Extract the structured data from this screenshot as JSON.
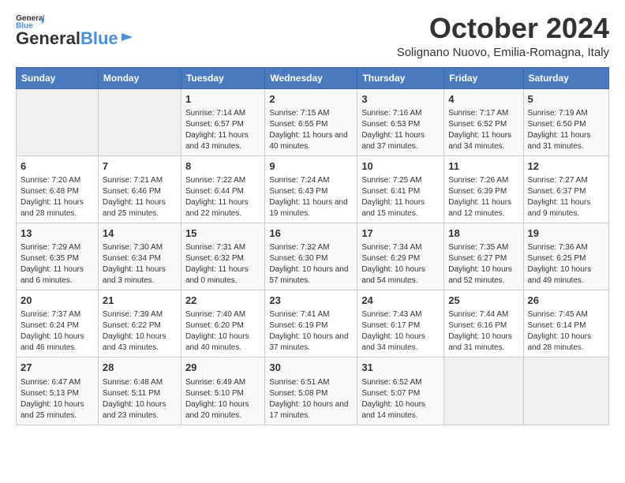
{
  "header": {
    "logo_line1": "General",
    "logo_line2": "Blue",
    "month": "October 2024",
    "location": "Solignano Nuovo, Emilia-Romagna, Italy"
  },
  "days_of_week": [
    "Sunday",
    "Monday",
    "Tuesday",
    "Wednesday",
    "Thursday",
    "Friday",
    "Saturday"
  ],
  "weeks": [
    [
      {
        "day": "",
        "info": ""
      },
      {
        "day": "",
        "info": ""
      },
      {
        "day": "1",
        "info": "Sunrise: 7:14 AM\nSunset: 6:57 PM\nDaylight: 11 hours and 43 minutes."
      },
      {
        "day": "2",
        "info": "Sunrise: 7:15 AM\nSunset: 6:55 PM\nDaylight: 11 hours and 40 minutes."
      },
      {
        "day": "3",
        "info": "Sunrise: 7:16 AM\nSunset: 6:53 PM\nDaylight: 11 hours and 37 minutes."
      },
      {
        "day": "4",
        "info": "Sunrise: 7:17 AM\nSunset: 6:52 PM\nDaylight: 11 hours and 34 minutes."
      },
      {
        "day": "5",
        "info": "Sunrise: 7:19 AM\nSunset: 6:50 PM\nDaylight: 11 hours and 31 minutes."
      }
    ],
    [
      {
        "day": "6",
        "info": "Sunrise: 7:20 AM\nSunset: 6:48 PM\nDaylight: 11 hours and 28 minutes."
      },
      {
        "day": "7",
        "info": "Sunrise: 7:21 AM\nSunset: 6:46 PM\nDaylight: 11 hours and 25 minutes."
      },
      {
        "day": "8",
        "info": "Sunrise: 7:22 AM\nSunset: 6:44 PM\nDaylight: 11 hours and 22 minutes."
      },
      {
        "day": "9",
        "info": "Sunrise: 7:24 AM\nSunset: 6:43 PM\nDaylight: 11 hours and 19 minutes."
      },
      {
        "day": "10",
        "info": "Sunrise: 7:25 AM\nSunset: 6:41 PM\nDaylight: 11 hours and 15 minutes."
      },
      {
        "day": "11",
        "info": "Sunrise: 7:26 AM\nSunset: 6:39 PM\nDaylight: 11 hours and 12 minutes."
      },
      {
        "day": "12",
        "info": "Sunrise: 7:27 AM\nSunset: 6:37 PM\nDaylight: 11 hours and 9 minutes."
      }
    ],
    [
      {
        "day": "13",
        "info": "Sunrise: 7:29 AM\nSunset: 6:35 PM\nDaylight: 11 hours and 6 minutes."
      },
      {
        "day": "14",
        "info": "Sunrise: 7:30 AM\nSunset: 6:34 PM\nDaylight: 11 hours and 3 minutes."
      },
      {
        "day": "15",
        "info": "Sunrise: 7:31 AM\nSunset: 6:32 PM\nDaylight: 11 hours and 0 minutes."
      },
      {
        "day": "16",
        "info": "Sunrise: 7:32 AM\nSunset: 6:30 PM\nDaylight: 10 hours and 57 minutes."
      },
      {
        "day": "17",
        "info": "Sunrise: 7:34 AM\nSunset: 6:29 PM\nDaylight: 10 hours and 54 minutes."
      },
      {
        "day": "18",
        "info": "Sunrise: 7:35 AM\nSunset: 6:27 PM\nDaylight: 10 hours and 52 minutes."
      },
      {
        "day": "19",
        "info": "Sunrise: 7:36 AM\nSunset: 6:25 PM\nDaylight: 10 hours and 49 minutes."
      }
    ],
    [
      {
        "day": "20",
        "info": "Sunrise: 7:37 AM\nSunset: 6:24 PM\nDaylight: 10 hours and 46 minutes."
      },
      {
        "day": "21",
        "info": "Sunrise: 7:39 AM\nSunset: 6:22 PM\nDaylight: 10 hours and 43 minutes."
      },
      {
        "day": "22",
        "info": "Sunrise: 7:40 AM\nSunset: 6:20 PM\nDaylight: 10 hours and 40 minutes."
      },
      {
        "day": "23",
        "info": "Sunrise: 7:41 AM\nSunset: 6:19 PM\nDaylight: 10 hours and 37 minutes."
      },
      {
        "day": "24",
        "info": "Sunrise: 7:43 AM\nSunset: 6:17 PM\nDaylight: 10 hours and 34 minutes."
      },
      {
        "day": "25",
        "info": "Sunrise: 7:44 AM\nSunset: 6:16 PM\nDaylight: 10 hours and 31 minutes."
      },
      {
        "day": "26",
        "info": "Sunrise: 7:45 AM\nSunset: 6:14 PM\nDaylight: 10 hours and 28 minutes."
      }
    ],
    [
      {
        "day": "27",
        "info": "Sunrise: 6:47 AM\nSunset: 5:13 PM\nDaylight: 10 hours and 25 minutes."
      },
      {
        "day": "28",
        "info": "Sunrise: 6:48 AM\nSunset: 5:11 PM\nDaylight: 10 hours and 23 minutes."
      },
      {
        "day": "29",
        "info": "Sunrise: 6:49 AM\nSunset: 5:10 PM\nDaylight: 10 hours and 20 minutes."
      },
      {
        "day": "30",
        "info": "Sunrise: 6:51 AM\nSunset: 5:08 PM\nDaylight: 10 hours and 17 minutes."
      },
      {
        "day": "31",
        "info": "Sunrise: 6:52 AM\nSunset: 5:07 PM\nDaylight: 10 hours and 14 minutes."
      },
      {
        "day": "",
        "info": ""
      },
      {
        "day": "",
        "info": ""
      }
    ]
  ]
}
